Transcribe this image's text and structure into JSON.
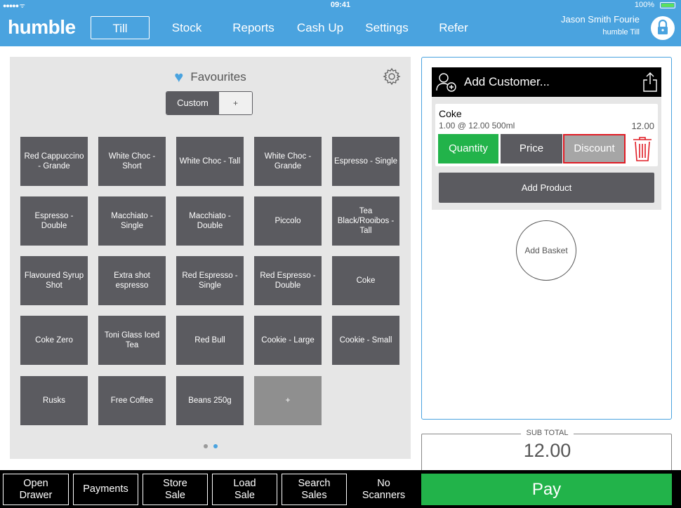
{
  "status_bar": {
    "time": "09:41",
    "battery": "100%"
  },
  "nav": {
    "logo": "humble",
    "tabs": [
      "Till",
      "Stock",
      "Reports",
      "Cash Up",
      "Settings",
      "Refer"
    ],
    "active_tab": "Till",
    "user_name": "Jason Smith Fourie",
    "user_till": "humble Till"
  },
  "favourites": {
    "title": "Favourites",
    "segment": {
      "custom": "Custom",
      "add": "+"
    },
    "tiles": [
      "Red Cappuccino - Grande",
      "White Choc - Short",
      "White Choc - Tall",
      "White Choc - Grande",
      "Espresso - Single",
      "Espresso - Double",
      "Macchiato - Single",
      "Macchiato - Double",
      "Piccolo",
      "Tea Black/Rooibos - Tall",
      "Flavoured Syrup Shot",
      "Extra shot espresso",
      "Red Espresso - Single",
      "Red Espresso - Double",
      "Coke",
      "Coke Zero",
      "Toni Glass Iced Tea",
      "Red Bull",
      "Cookie - Large",
      "Cookie - Small",
      "Rusks",
      "Free Coffee",
      "Beans 250g",
      "+"
    ],
    "page_count": 2,
    "active_page": 2
  },
  "basket": {
    "add_customer": "Add Customer...",
    "item": {
      "name": "Coke",
      "detail": "1.00 @ 12.00 500ml",
      "total": "12.00",
      "quantity_label": "Quantity",
      "price_label": "Price",
      "discount_label": "Discount"
    },
    "add_product": "Add Product",
    "add_basket": "Add Basket"
  },
  "subtotal": {
    "label": "SUB TOTAL",
    "value": "12.00"
  },
  "bottom_bar": {
    "open_drawer": "Open\nDrawer",
    "payments": "Payments",
    "store_sale": "Store\nSale",
    "load_sale": "Load\nSale",
    "search_sales": "Search\nSales",
    "no_scanners": "No\nScanners",
    "pay": "Pay"
  },
  "colors": {
    "brand_blue": "#4aa3df",
    "tile_grey": "#5b5b60",
    "pay_green": "#22b34a",
    "delete_red": "#e01b24"
  }
}
